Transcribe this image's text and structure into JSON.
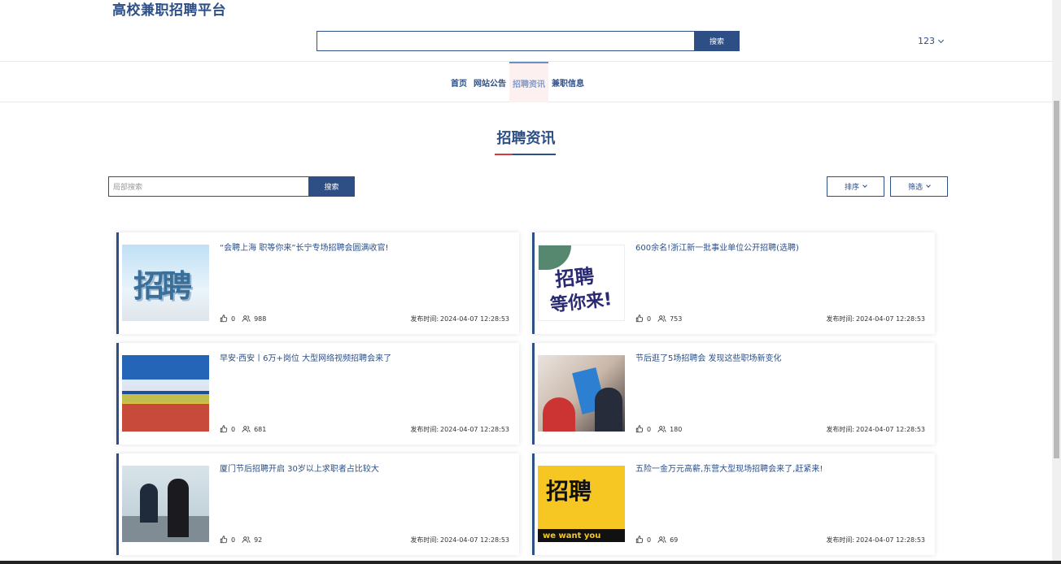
{
  "header": {
    "site_title": "高校兼职招聘平台",
    "search_button": "搜索",
    "user_name": "123"
  },
  "nav": {
    "items": [
      {
        "label": "首页",
        "active": false
      },
      {
        "label": "网站公告",
        "active": false
      },
      {
        "label": "招聘资讯",
        "active": true
      },
      {
        "label": "兼职信息",
        "active": false
      }
    ]
  },
  "page": {
    "title": "招聘资讯",
    "local_search_placeholder": "局部搜索",
    "local_search_button": "搜索",
    "sort_label": "排序",
    "filter_label": "筛选"
  },
  "theme": {
    "primary": "#2d4f86",
    "accent_red": "#d9383a"
  },
  "icons": {
    "like": "thumbs-up-icon",
    "views": "users-icon"
  },
  "thumb_text": {
    "t1": "招聘",
    "t2a": "招聘",
    "t2b": "等你来!",
    "t6": "招聘",
    "t6b": "we want you"
  },
  "cards": [
    {
      "title": "“会聘上海 职等你来”长宁专场招聘会圆满收官!",
      "likes": "0",
      "views": "988",
      "date_label": "发布时间:",
      "date": "2024-04-07 12:28:53"
    },
    {
      "title": "600余名!浙江新一批事业单位公开招聘(选聘)",
      "likes": "0",
      "views": "753",
      "date_label": "发布时间:",
      "date": "2024-04-07 12:28:53"
    },
    {
      "title": "早安·西安丨6万+岗位 大型网络视频招聘会来了",
      "likes": "0",
      "views": "681",
      "date_label": "发布时间:",
      "date": "2024-04-07 12:28:53"
    },
    {
      "title": "节后逛了5场招聘会 发现这些职场新变化",
      "likes": "0",
      "views": "180",
      "date_label": "发布时间:",
      "date": "2024-04-07 12:28:53"
    },
    {
      "title": "厦门节后招聘开启 30岁以上求职者占比较大",
      "likes": "0",
      "views": "92",
      "date_label": "发布时间:",
      "date": "2024-04-07 12:28:53"
    },
    {
      "title": "五险一金万元高薪,东营大型现场招聘会来了,赶紧来!",
      "likes": "0",
      "views": "69",
      "date_label": "发布时间:",
      "date": "2024-04-07 12:28:53"
    }
  ]
}
